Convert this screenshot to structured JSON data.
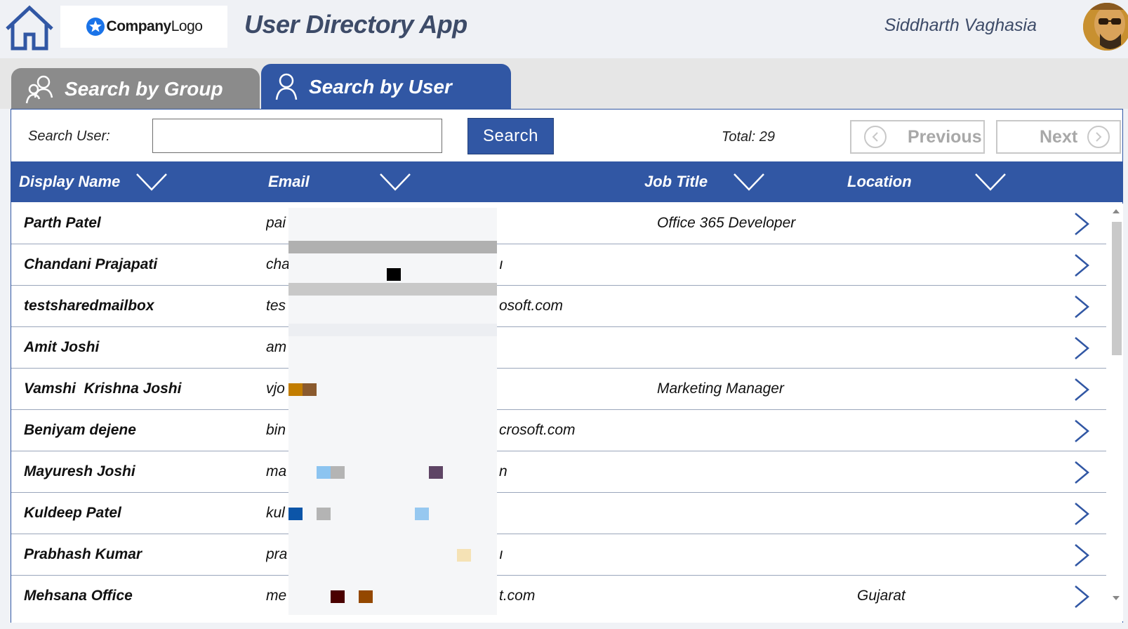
{
  "header": {
    "logo_text_bold": "Company",
    "logo_text_light": "Logo",
    "app_title": "User Directory App",
    "user_name": "Siddharth Vaghasia"
  },
  "tabs": [
    {
      "label": "Search by Group",
      "active": false
    },
    {
      "label": "Search by User",
      "active": true
    }
  ],
  "search": {
    "label": "Search User:",
    "value": "",
    "button_label": "Search"
  },
  "total_text": "Total: 29",
  "pager": {
    "previous_label": "Previous",
    "next_label": "Next"
  },
  "columns": [
    "Display Name",
    "Email",
    "Job Title",
    "Location"
  ],
  "rows": [
    {
      "name": "Parth Patel",
      "email": "pai",
      "job": "Office 365 Developer",
      "location": ""
    },
    {
      "name": "Chandani Prajapati",
      "email": "cha",
      "email_tail": "ı",
      "job": "",
      "location": ""
    },
    {
      "name": "testsharedmailbox",
      "email": "tes",
      "email_tail": "osoft.com",
      "job": "",
      "location": ""
    },
    {
      "name": "Amit Joshi",
      "email": "am",
      "job": "",
      "location": ""
    },
    {
      "name": "Vamshi  Krishna Joshi",
      "email": "vjo",
      "job": "Marketing Manager",
      "location": ""
    },
    {
      "name": "Beniyam dejene",
      "email": "bin",
      "email_tail": "crosoft.com",
      "job": "",
      "location": ""
    },
    {
      "name": "Mayuresh Joshi",
      "email": "ma",
      "email_tail": "n",
      "job": "",
      "location": ""
    },
    {
      "name": "Kuldeep Patel",
      "email": "kul",
      "job": "",
      "location": ""
    },
    {
      "name": "Prabhash Kumar",
      "email": "pra",
      "email_tail": "ı",
      "job": "",
      "location": ""
    },
    {
      "name": "Mehsana Office",
      "email": "me",
      "email_tail": "t.com",
      "job": "",
      "location": "Gujarat"
    }
  ],
  "colors": {
    "brand_blue": "#3157a4",
    "inactive_tab": "#8b8b8b",
    "title_text": "#3d4b68"
  },
  "icons": [
    "home-icon",
    "star-icon",
    "group-icon",
    "user-icon",
    "chevron-down-icon",
    "chevron-left-icon",
    "chevron-right-icon"
  ]
}
